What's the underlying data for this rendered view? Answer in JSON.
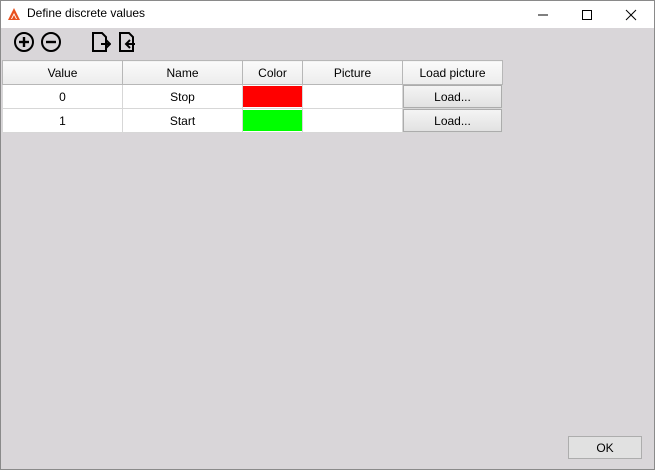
{
  "window": {
    "title": "Define discrete values",
    "app_icon": "app-logo-icon",
    "controls": {
      "minimize": "minimize-icon",
      "maximize": "maximize-icon",
      "close": "close-icon"
    }
  },
  "toolbar": {
    "icons": [
      "add-circle-icon",
      "remove-circle-icon",
      "import-file-icon",
      "export-file-icon"
    ]
  },
  "table": {
    "columns": [
      "Value",
      "Name",
      "Color",
      "Picture",
      "Load picture"
    ],
    "rows": [
      {
        "value": "0",
        "name": "Stop",
        "color": "#ff0000",
        "picture": "",
        "load_label": "Load..."
      },
      {
        "value": "1",
        "name": "Start",
        "color": "#00ff00",
        "picture": "",
        "load_label": "Load..."
      }
    ]
  },
  "footer": {
    "ok_label": "OK"
  },
  "colors": {
    "window_bg": "#d9d6d9",
    "titlebar_bg": "#ffffff",
    "app_icon": "#e8501e"
  }
}
